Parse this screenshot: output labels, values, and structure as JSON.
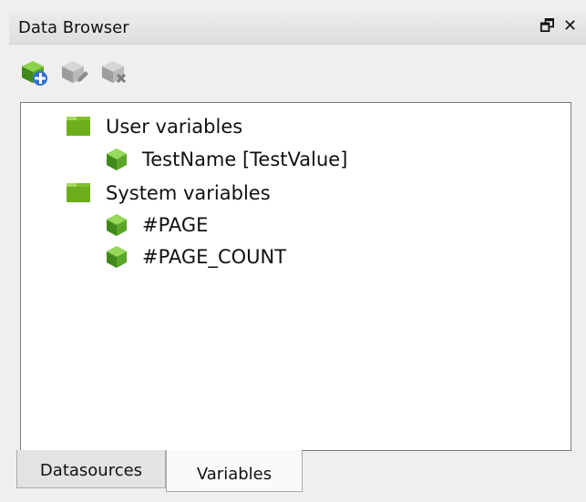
{
  "window": {
    "title": "Data Browser",
    "restore_glyph": "🗗",
    "close_glyph": "✕"
  },
  "toolbar": {
    "buttons": [
      {
        "icon": "add-variable-icon",
        "enabled": true
      },
      {
        "icon": "edit-variable-icon",
        "enabled": false
      },
      {
        "icon": "delete-variable-icon",
        "enabled": false
      }
    ]
  },
  "tree": {
    "groups": [
      {
        "label": "User variables",
        "expanded": true,
        "items": [
          {
            "label": "TestName  [TestValue]"
          }
        ]
      },
      {
        "label": "System variables",
        "expanded": true,
        "items": [
          {
            "label": "#PAGE"
          },
          {
            "label": "#PAGE_COUNT"
          }
        ]
      }
    ]
  },
  "tabs": {
    "items": [
      {
        "label": "Datasources",
        "active": false
      },
      {
        "label": "Variables",
        "active": true
      }
    ]
  },
  "colors": {
    "folder_green": "#7fbf2a",
    "cube_green": "#5aa52a",
    "add_blue": "#2f6fd6"
  }
}
